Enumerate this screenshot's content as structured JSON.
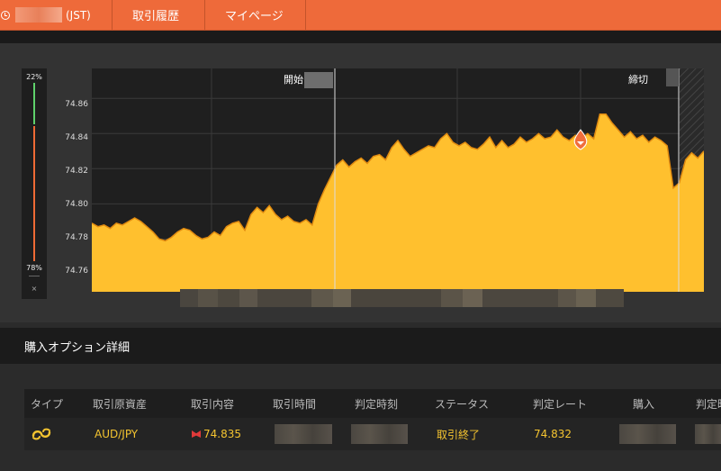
{
  "topbar": {
    "timezone_suffix": "(JST)",
    "nav": [
      "取引履歴",
      "マイページ"
    ]
  },
  "gauge": {
    "top_pct": "22%",
    "bottom_pct": "78%",
    "close": "×"
  },
  "chart_labels": {
    "start": "開始",
    "end": "締切"
  },
  "details": {
    "title": "購入オプション詳細"
  },
  "table": {
    "headers": [
      "タイプ",
      "取引原資産",
      "取引内容",
      "取引時間",
      "判定時刻",
      "ステータス",
      "判定レート",
      "購入",
      "判定時"
    ],
    "row": {
      "asset": "AUD/JPY",
      "content": "74.835",
      "status": "取引終了",
      "rate": "74.832"
    }
  },
  "colors": {
    "accent": "#ee6a3a",
    "area": "#ffc02e",
    "gold": "#f4c430",
    "marker": "#f06d3b"
  },
  "chart_data": {
    "type": "area",
    "y_ticks": [
      "74.86",
      "74.84",
      "74.82",
      "74.80",
      "74.78",
      "74.76"
    ],
    "ylim": [
      74.75,
      74.877
    ],
    "grid": true,
    "annotations": [
      "開始",
      "締切"
    ],
    "series": [
      {
        "values": [
          74.789,
          74.787,
          74.788,
          74.786,
          74.789,
          74.788,
          74.79,
          74.792,
          74.79,
          74.787,
          74.784,
          74.78,
          74.779,
          74.781,
          74.784,
          74.786,
          74.785,
          74.782,
          74.78,
          74.781,
          74.784,
          74.782,
          74.787,
          74.789,
          74.79,
          74.785,
          74.794,
          74.798,
          74.795,
          74.799,
          74.794,
          74.791,
          74.793,
          74.79,
          74.789,
          74.791,
          74.788,
          74.8,
          74.808,
          74.815,
          74.822,
          74.825,
          74.821,
          74.824,
          74.826,
          74.823,
          74.827,
          74.828,
          74.825,
          74.832,
          74.836,
          74.831,
          74.827,
          74.829,
          74.831,
          74.833,
          74.832,
          74.837,
          74.84,
          74.835,
          74.833,
          74.835,
          74.832,
          74.831,
          74.834,
          74.838,
          74.832,
          74.836,
          74.832,
          74.834,
          74.838,
          74.835,
          74.837,
          74.84,
          74.837,
          74.838,
          74.842,
          74.838,
          74.836,
          74.839,
          74.837,
          74.84,
          74.837,
          74.851,
          74.851,
          74.846,
          74.842,
          74.838,
          74.841,
          74.837,
          74.839,
          74.835,
          74.838,
          74.836,
          74.833,
          74.809,
          74.812,
          74.825,
          74.829,
          74.826,
          74.83
        ]
      }
    ],
    "marker": {
      "value": 74.835
    }
  }
}
